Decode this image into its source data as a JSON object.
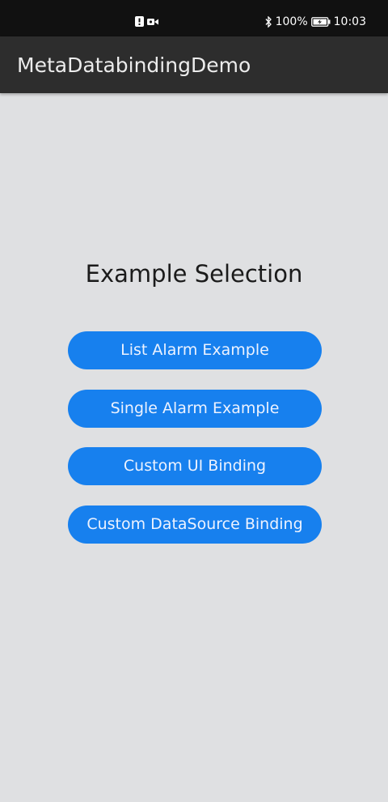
{
  "status_bar": {
    "battery_percent": "100%",
    "time": "10:03",
    "icons": [
      "notification-alert-icon",
      "video-camera-icon",
      "bluetooth-icon",
      "battery-charging-icon"
    ]
  },
  "app_bar": {
    "title": "MetaDatabindingDemo"
  },
  "main": {
    "title": "Example Selection",
    "buttons": [
      {
        "label": "List Alarm Example"
      },
      {
        "label": "Single Alarm Example"
      },
      {
        "label": "Custom UI Binding"
      },
      {
        "label": "Custom DataSource Binding"
      }
    ]
  },
  "colors": {
    "status_bar_bg": "#111111",
    "app_bar_bg": "#2d2d2d",
    "page_bg": "#dfe0e2",
    "button_bg": "#1780ee",
    "button_text": "#ecf2ff"
  }
}
